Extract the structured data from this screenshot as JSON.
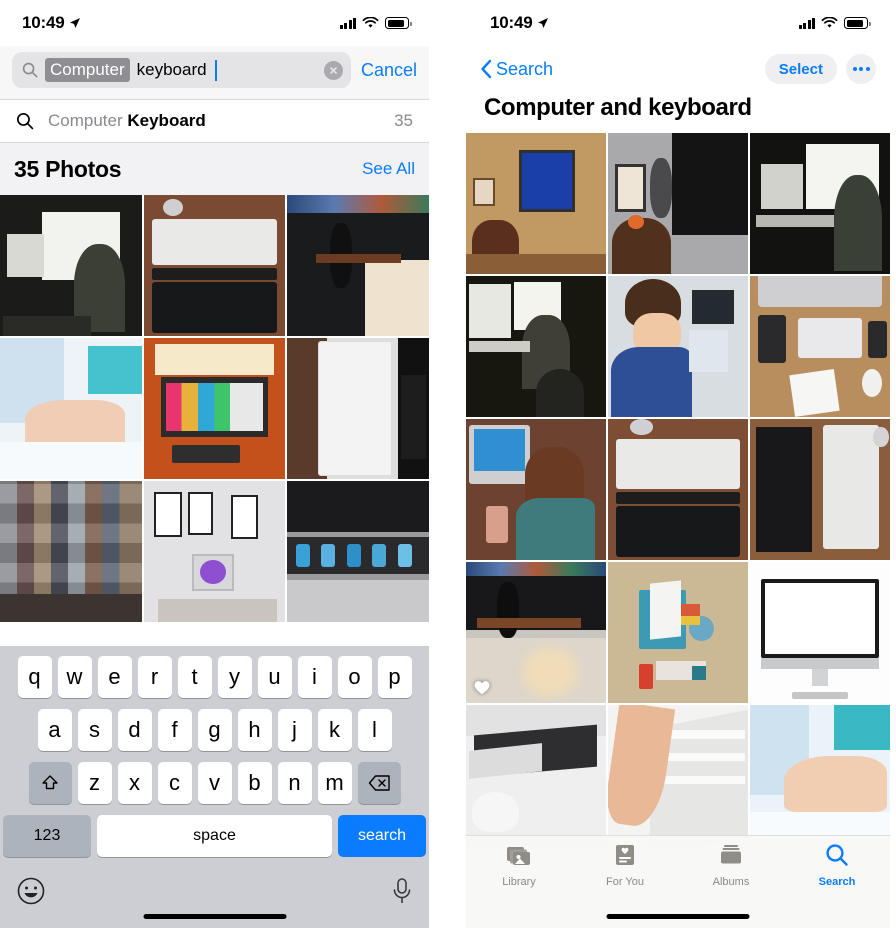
{
  "left": {
    "status": {
      "time": "10:49",
      "location_icon": "location-arrow-icon",
      "signal_icon": "cellular-bars-icon",
      "wifi_icon": "wifi-icon",
      "battery_icon": "battery-icon"
    },
    "search": {
      "icon": "search-icon",
      "token": "Computer",
      "typed": "keyboard",
      "clear_icon": "clear-circle-icon",
      "cancel_label": "Cancel"
    },
    "suggestion": {
      "icon": "search-icon",
      "prefix": "Computer ",
      "bold": "Keyboard",
      "count": "35"
    },
    "photos_header": {
      "title": "35 Photos",
      "see_all_label": "See All"
    },
    "keyboard": {
      "row1": [
        "q",
        "w",
        "e",
        "r",
        "t",
        "y",
        "u",
        "i",
        "o",
        "p"
      ],
      "row2": [
        "a",
        "s",
        "d",
        "f",
        "g",
        "h",
        "j",
        "k",
        "l"
      ],
      "row3": [
        "z",
        "x",
        "c",
        "v",
        "b",
        "n",
        "m"
      ],
      "shift_icon": "shift-up-arrow-icon",
      "delete_icon": "backspace-delete-icon",
      "numeric_label": "123",
      "space_label": "space",
      "search_label": "search",
      "emoji_icon": "smiley-emoji-icon",
      "dictation_icon": "microphone-icon"
    },
    "grid": [
      {
        "name": "bw-person-at-imac-desk",
        "alt": "Black and white person at iMac desk"
      },
      {
        "name": "apple-keyboard-and-macbook-on-wood-desk",
        "alt": "Apple keyboard over MacBook on wood desk"
      },
      {
        "name": "macbook-keyboard-closeup-with-headphones",
        "alt": "MacBook keyboard close up"
      },
      {
        "name": "hands-typing-on-white-keyboard",
        "alt": "Hands typing on white keyboard"
      },
      {
        "name": "colorful-monitor-with-orange-lighting",
        "alt": "Monitor with color bars and orange light panels"
      },
      {
        "name": "samsung-phone-held-over-laptop",
        "alt": "Samsung phone box held over laptop"
      },
      {
        "name": "blurred-pixelated-photo",
        "alt": "Pixelated photo"
      },
      {
        "name": "imac-desk-with-framed-wall-art",
        "alt": "iMac desk with framed wall art"
      },
      {
        "name": "macbook-pro-touch-bar-closeup",
        "alt": "MacBook Pro touch bar close up"
      }
    ]
  },
  "right": {
    "status": {
      "time": "10:49",
      "location_icon": "location-arrow-icon",
      "signal_icon": "cellular-bars-icon",
      "wifi_icon": "wifi-icon",
      "battery_icon": "battery-icon"
    },
    "nav": {
      "back_icon": "chevron-left-icon",
      "back_label": "Search",
      "select_label": "Select",
      "more_icon": "ellipsis-icon"
    },
    "title": "Computer and  keyboard",
    "grid": [
      {
        "name": "child-at-blue-screen-crt-monitor",
        "alt": "Child at desk with blue-screen monitor"
      },
      {
        "name": "girl-with-hair-bow-at-computer",
        "alt": "Girl with hair bow typing at computer"
      },
      {
        "name": "bw-woman-at-imac-by-window",
        "alt": "Black and white woman at iMac by window"
      },
      {
        "name": "bw-child-in-office-at-imac",
        "alt": "Black and white child in office at iMac"
      },
      {
        "name": "smiling-man-in-blue-shirt-at-computer",
        "alt": "Smiling man in blue shirt at computer"
      },
      {
        "name": "imac-keyboard-tablet-flatlay-on-wood",
        "alt": "iMac keyboard and tablet flatlay on wood desk"
      },
      {
        "name": "child-in-pajamas-at-imac",
        "alt": "Child in star pajamas at iMac"
      },
      {
        "name": "apple-keyboard-over-macbook-topdown",
        "alt": "Apple keyboard over MacBook top-down"
      },
      {
        "name": "two-keyboards-side-by-side-on-desk",
        "alt": "Black and white keyboards side by side"
      },
      {
        "name": "macbook-keyboard-with-headphones",
        "alt": "MacBook keyboard with headphones",
        "favorite": true
      },
      {
        "name": "isometric-illustration-desk-education",
        "alt": "Isometric illustration of desk and computer"
      },
      {
        "name": "imac-blank-white-screen",
        "alt": "iMac with blank white screen"
      },
      {
        "name": "bw-imac-keyboard-and-magic-mouse",
        "alt": "Black and white iMac keyboard and Magic Mouse"
      },
      {
        "name": "finger-pressing-white-keyboard-key",
        "alt": "Finger pressing a white keyboard key"
      },
      {
        "name": "hands-typing-bright-office",
        "alt": "Hands typing in bright office"
      }
    ],
    "tabbar": [
      {
        "label": "Library",
        "icon": "photos-library-icon",
        "active": false
      },
      {
        "label": "For You",
        "icon": "for-you-heart-card-icon",
        "active": false
      },
      {
        "label": "Albums",
        "icon": "albums-stack-icon",
        "active": false
      },
      {
        "label": "Search",
        "icon": "search-icon",
        "active": true
      }
    ]
  },
  "colors": {
    "accent": "#0a7cff",
    "token_bg": "#8e8e93",
    "field_bg": "#e4e4e6",
    "keyboard_bg": "#ccced3",
    "header_bg": "#f2f2f4"
  }
}
